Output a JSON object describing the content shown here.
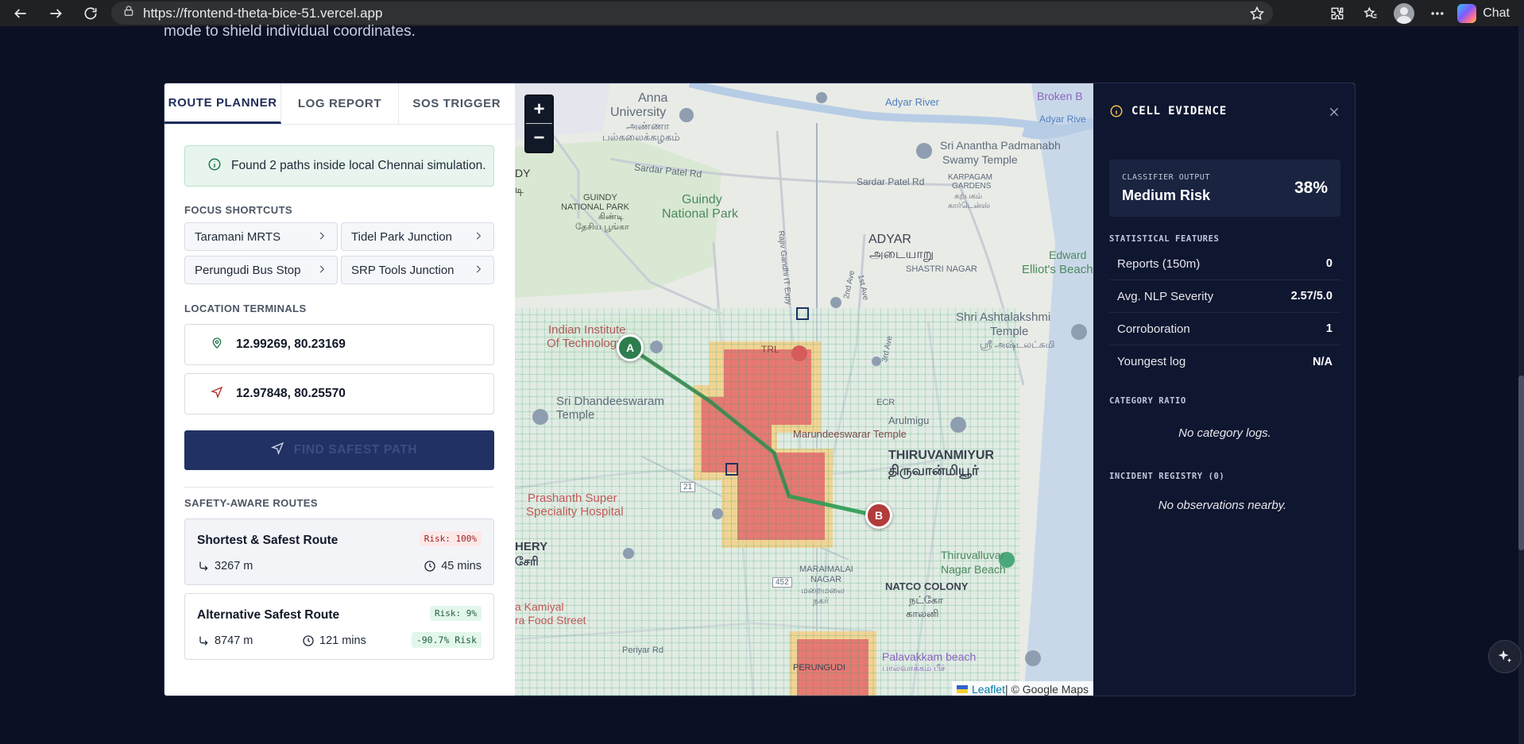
{
  "browser": {
    "url": "https://frontend-theta-bice-51.vercel.app",
    "chat_label": "Chat"
  },
  "page": {
    "intro_fragment": "mode to shield individual coordinates."
  },
  "tabs": [
    {
      "label": "ROUTE PLANNER",
      "active": true
    },
    {
      "label": "LOG REPORT",
      "active": false
    },
    {
      "label": "SOS TRIGGER",
      "active": false
    }
  ],
  "planner": {
    "notice": "Found 2 paths inside local Chennai simulation.",
    "focus_label": "FOCUS SHORTCUTS",
    "shortcuts": [
      "Taramani MRTS",
      "Tidel Park Junction",
      "Perungudi Bus Stop",
      "SRP Tools Junction"
    ],
    "terminals_label": "LOCATION TERMINALS",
    "origin": "12.99269, 80.23169",
    "destination": "12.97848, 80.25570",
    "find_button": "FIND SAFEST PATH",
    "routes_label": "SAFETY-AWARE ROUTES",
    "routes": [
      {
        "name": "Shortest & Safest Route",
        "risk": "Risk: 100%",
        "distance": "3267 m",
        "time": "45 mins"
      },
      {
        "name": "Alternative Safest Route",
        "risk": "Risk: 9%",
        "distance": "8747 m",
        "time": "121 mins",
        "delta": "-90.7% Risk"
      }
    ]
  },
  "map": {
    "zoom_in": "+",
    "zoom_out": "−",
    "marker_a": "A",
    "marker_b": "B",
    "attribution_leaflet": "Leaflet",
    "attribution_rest": " | © Google Maps",
    "labels": [
      {
        "text": "Anna",
        "id": "anna"
      },
      {
        "text": "University",
        "id": "univ"
      },
      {
        "text": "அண்ணா",
        "id": "anna-ta"
      },
      {
        "text": "பல்கலைக்கழகம்",
        "id": "univ-ta"
      },
      {
        "text": "Adyar River",
        "id": "adyar-river"
      },
      {
        "text": "Broken B",
        "id": "broken"
      },
      {
        "text": "Adyar Rive",
        "id": "adyar-rive"
      },
      {
        "text": "Sri Anantha Padmanabh",
        "id": "anantha1"
      },
      {
        "text": "Swamy Temple",
        "id": "anantha2"
      },
      {
        "text": "Sardar Patel Rd",
        "id": "sardar1"
      },
      {
        "text": "Sardar Patel Rd",
        "id": "sardar2"
      },
      {
        "text": "KARPAGAM",
        "id": "karp1"
      },
      {
        "text": "GARDENS",
        "id": "karp2"
      },
      {
        "text": "கற்பகம்",
        "id": "karp3"
      },
      {
        "text": "கார்டென்ஸ்",
        "id": "karp4"
      },
      {
        "text": "DY",
        "id": "dy"
      },
      {
        "text": "டி",
        "id": "dy-ta"
      },
      {
        "text": "GUINDY",
        "id": "gnp1"
      },
      {
        "text": "NATIONAL PARK",
        "id": "gnp2"
      },
      {
        "text": "கிண்டி",
        "id": "gnp3"
      },
      {
        "text": "தேசிய பூங்கா",
        "id": "gnp4"
      },
      {
        "text": "Guindy",
        "id": "gnp5"
      },
      {
        "text": "National Park",
        "id": "gnp6"
      },
      {
        "text": "ADYAR",
        "id": "adyar"
      },
      {
        "text": "அடையாறு",
        "id": "adyar-ta"
      },
      {
        "text": "SHASTRI NAGAR",
        "id": "shastri"
      },
      {
        "text": "Edward",
        "id": "edward"
      },
      {
        "text": "Elliot's Beach",
        "id": "elliot"
      },
      {
        "text": "Rajiv Gandhi IT Expy",
        "id": "rgexpy"
      },
      {
        "text": "1st Ave",
        "id": "ave1"
      },
      {
        "text": "2nd Ave",
        "id": "ave2"
      },
      {
        "text": "3rd Ave",
        "id": "ave3"
      },
      {
        "text": "Indian Institute",
        "id": "iit1"
      },
      {
        "text": "Of Technology",
        "id": "iit2"
      },
      {
        "text": "Shri Ashtalakshmi",
        "id": "ashta1"
      },
      {
        "text": "Temple",
        "id": "ashta2"
      },
      {
        "text": "ஸ்ரீ அஷ்டலட்சுமி",
        "id": "ashta3"
      },
      {
        "text": "TRL",
        "id": "trl"
      },
      {
        "text": "Sri Dhandeeswaram",
        "id": "dhand1"
      },
      {
        "text": "Temple",
        "id": "dhand2"
      },
      {
        "text": "ECR",
        "id": "ecr"
      },
      {
        "text": "Arulmigu",
        "id": "arul"
      },
      {
        "text": "Marundeeswarar Temple",
        "id": "marun"
      },
      {
        "text": "THIRUVANMIYUR",
        "id": "thiru"
      },
      {
        "text": "திருவான்மியூர்",
        "id": "thiru-ta"
      },
      {
        "text": "Prashanth Super",
        "id": "prash1"
      },
      {
        "text": "Speciality Hospital",
        "id": "prash2"
      },
      {
        "text": "HERY",
        "id": "hery"
      },
      {
        "text": "சேரி",
        "id": "hery-ta"
      },
      {
        "text": "Thiruvalluvar",
        "id": "valluvar1"
      },
      {
        "text": "Nagar Beach",
        "id": "valluvar2"
      },
      {
        "text": "MARAIMALAI",
        "id": "marai1"
      },
      {
        "text": "NAGAR",
        "id": "marai2"
      },
      {
        "text": "மறைமலை",
        "id": "marai3"
      },
      {
        "text": "நகர்",
        "id": "marai4"
      },
      {
        "text": "NATCO COLONY",
        "id": "natco1"
      },
      {
        "text": "நட்கோ",
        "id": "natco2"
      },
      {
        "text": "காலனி",
        "id": "natco3"
      },
      {
        "text": "a Kamiyal",
        "id": "kam1"
      },
      {
        "text": "ra Food Street",
        "id": "kam2"
      },
      {
        "text": "Periyar Rd",
        "id": "periyar"
      },
      {
        "text": "Palavakkam beach",
        "id": "pala1"
      },
      {
        "text": "பாலவாக்கம் பீச்",
        "id": "pala2"
      },
      {
        "text": "PERUNGUDI",
        "id": "perun"
      },
      {
        "text": "452",
        "id": "r452"
      },
      {
        "text": "21",
        "id": "r21"
      }
    ]
  },
  "evidence": {
    "title": "CELL EVIDENCE",
    "classifier_key": "CLASSIFIER OUTPUT",
    "classifier_value": "Medium Risk",
    "classifier_pct": "38%",
    "stats_label": "STATISTICAL FEATURES",
    "stats": [
      {
        "key": "Reports (150m)",
        "value": "0"
      },
      {
        "key": "Avg. NLP Severity",
        "value": "2.57/5.0"
      },
      {
        "key": "Corroboration",
        "value": "1"
      },
      {
        "key": "Youngest log",
        "value": "N/A"
      }
    ],
    "category_label": "CATEGORY RATIO",
    "category_empty": "No category logs.",
    "registry_label": "INCIDENT REGISTRY (0)",
    "registry_empty": "No observations nearby."
  },
  "colors": {
    "navy": "#213163",
    "risk_red": "#e66f6f",
    "risk_amber": "#f3d28c",
    "route_green": "#2e9a52",
    "grid_green": "#2ea36b"
  }
}
